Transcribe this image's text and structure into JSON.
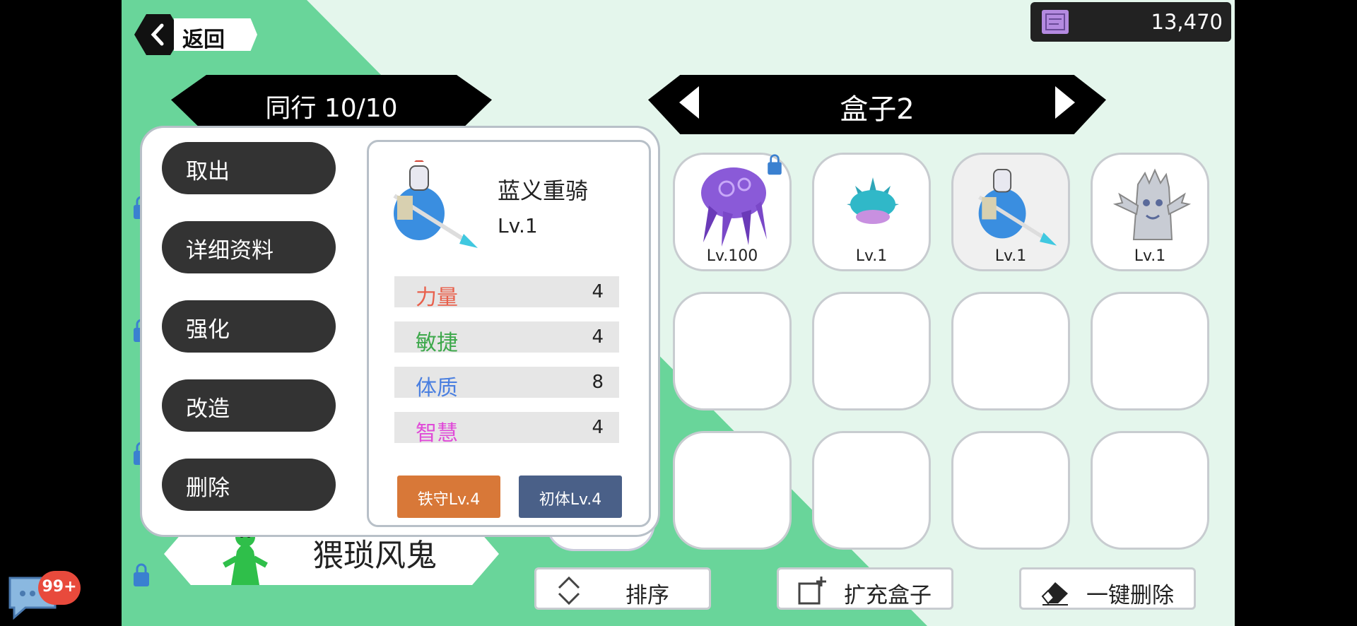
{
  "back": {
    "label": "返回"
  },
  "currency": {
    "amount": "13,470",
    "icon": "ticket-icon"
  },
  "party": {
    "title": "同行 10/10",
    "bottom_creature_name": "猥琐风鬼"
  },
  "box": {
    "title": "盒子2"
  },
  "menu": [
    {
      "label": "取出"
    },
    {
      "label": "详细资料"
    },
    {
      "label": "强化"
    },
    {
      "label": "改造"
    },
    {
      "label": "删除"
    }
  ],
  "detail": {
    "name": "蓝义重骑",
    "level": "Lv.1",
    "stats": [
      {
        "name": "力量",
        "value": "4",
        "color": "#e8604c"
      },
      {
        "name": "敏捷",
        "value": "4",
        "color": "#3ca84a"
      },
      {
        "name": "体质",
        "value": "8",
        "color": "#4a7fe0"
      },
      {
        "name": "智慧",
        "value": "4",
        "color": "#e04ad8"
      }
    ],
    "skills": [
      {
        "label": "铁守Lv.4",
        "color": "#d87838"
      },
      {
        "label": "初体Lv.4",
        "color": "#4a6088"
      }
    ]
  },
  "slots": [
    {
      "level": "Lv.100",
      "icon": "purple-octopus-icon",
      "locked": true
    },
    {
      "level": "Lv.1",
      "icon": "spiky-urchin-icon",
      "locked": false
    },
    {
      "level": "Lv.1",
      "icon": "blue-knight-icon",
      "locked": false
    },
    {
      "level": "Lv.1",
      "icon": "tree-ghost-icon",
      "locked": false
    }
  ],
  "bottom": {
    "sort": "排序",
    "expand": "扩充盒子",
    "delete_all": "一键删除"
  },
  "chat": {
    "badge": "99+"
  }
}
